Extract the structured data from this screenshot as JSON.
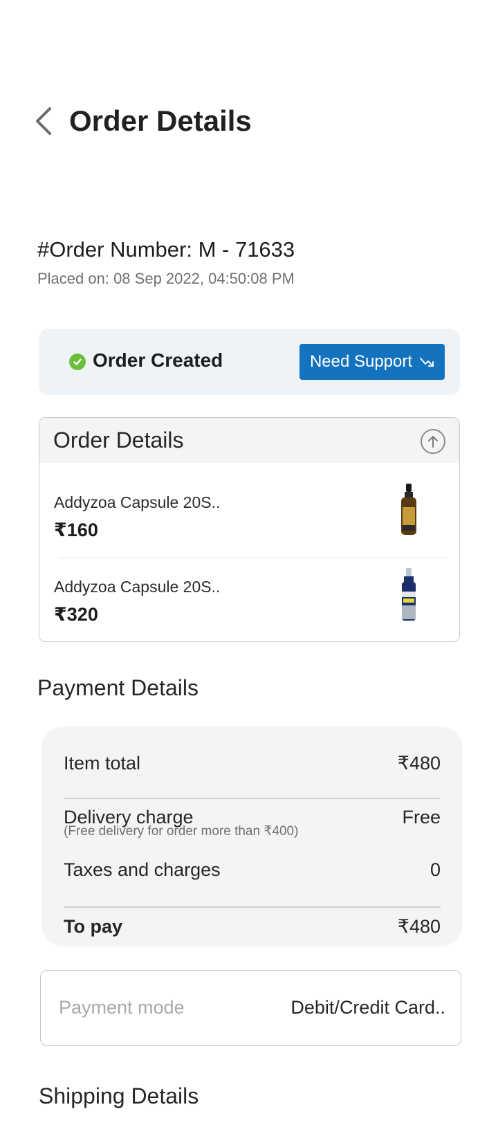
{
  "header": {
    "title": "Order Details",
    "back_icon": "chevron-left-icon"
  },
  "order": {
    "number": "#Order Number: M - 71633",
    "placed_on": "Placed on: 08 Sep 2022, 04:50:08 PM"
  },
  "status": {
    "text": "Order Created",
    "icon": "check-circle-icon",
    "color": "#6cbf3a",
    "support_label": "Need Support",
    "support_icon": "arrow-up-right-icon",
    "support_color": "#1473be"
  },
  "order_details": {
    "title": "Order Details",
    "collapse_icon": "arrow-up-circle-icon",
    "items": [
      {
        "name": "Addyzoa Capsule 20S..",
        "price": "₹160",
        "thumbnail": "amber-bottle-image"
      },
      {
        "name": "Addyzoa Capsule 20S..",
        "price": "₹320",
        "thumbnail": "blue-bottle-image"
      }
    ]
  },
  "payment": {
    "title": "Payment Details",
    "item_total_label": "Item total",
    "item_total_value": "₹480",
    "delivery_label": "Delivery charge",
    "delivery_value": "Free",
    "delivery_note": "(Free delivery for order more than ₹400)",
    "taxes_label": "Taxes and charges",
    "taxes_value": "0",
    "to_pay_label": "To pay",
    "to_pay_value": "₹480",
    "mode_label": "Payment mode",
    "mode_value": "Debit/Credit Card.."
  },
  "shipping": {
    "title": "Shipping Details"
  }
}
